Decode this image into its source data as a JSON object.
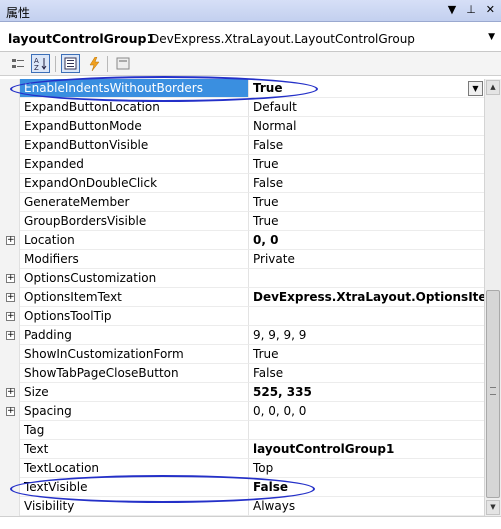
{
  "panel": {
    "title": "属性",
    "icons": [
      "dropdown-arrow-icon",
      "pin-icon",
      "close-icon"
    ]
  },
  "object_selector": {
    "name": "layoutControlGroup1",
    "type": "DevExpress.XtraLayout.LayoutControlGroup"
  },
  "toolbar": {
    "buttons": [
      {
        "name": "categorized-icon",
        "active": false
      },
      {
        "name": "alphabetical-sort-icon",
        "active": true
      },
      {
        "name": "properties-icon",
        "active": true
      },
      {
        "name": "events-lightning-icon",
        "active": false
      },
      {
        "name": "property-pages-icon",
        "active": false
      }
    ]
  },
  "properties": [
    {
      "name": "EnableIndentsWithoutBorders",
      "value": "True",
      "bold": true,
      "expandable": false,
      "selected": true
    },
    {
      "name": "ExpandButtonLocation",
      "value": "Default",
      "bold": false,
      "expandable": false
    },
    {
      "name": "ExpandButtonMode",
      "value": "Normal",
      "bold": false,
      "expandable": false
    },
    {
      "name": "ExpandButtonVisible",
      "value": "False",
      "bold": false,
      "expandable": false
    },
    {
      "name": "Expanded",
      "value": "True",
      "bold": false,
      "expandable": false
    },
    {
      "name": "ExpandOnDoubleClick",
      "value": "False",
      "bold": false,
      "expandable": false
    },
    {
      "name": "GenerateMember",
      "value": "True",
      "bold": false,
      "expandable": false
    },
    {
      "name": "GroupBordersVisible",
      "value": "True",
      "bold": false,
      "expandable": false
    },
    {
      "name": "Location",
      "value": "0, 0",
      "bold": true,
      "expandable": true
    },
    {
      "name": "Modifiers",
      "value": "Private",
      "bold": false,
      "expandable": false
    },
    {
      "name": "OptionsCustomization",
      "value": "",
      "bold": false,
      "expandable": true
    },
    {
      "name": "OptionsItemText",
      "value": "DevExpress.XtraLayout.OptionsItemTe",
      "bold": true,
      "expandable": true
    },
    {
      "name": "OptionsToolTip",
      "value": "",
      "bold": false,
      "expandable": true
    },
    {
      "name": "Padding",
      "value": "9, 9, 9, 9",
      "bold": false,
      "expandable": true
    },
    {
      "name": "ShowInCustomizationForm",
      "value": "True",
      "bold": false,
      "expandable": false
    },
    {
      "name": "ShowTabPageCloseButton",
      "value": "False",
      "bold": false,
      "expandable": false
    },
    {
      "name": "Size",
      "value": "525, 335",
      "bold": true,
      "expandable": true
    },
    {
      "name": "Spacing",
      "value": "0, 0, 0, 0",
      "bold": false,
      "expandable": true
    },
    {
      "name": "Tag",
      "value": "",
      "bold": false,
      "expandable": false
    },
    {
      "name": "Text",
      "value": "layoutControlGroup1",
      "bold": true,
      "expandable": false
    },
    {
      "name": "TextLocation",
      "value": "Top",
      "bold": false,
      "expandable": false
    },
    {
      "name": "TextVisible",
      "value": "False",
      "bold": true,
      "expandable": false
    },
    {
      "name": "Visibility",
      "value": "Always",
      "bold": false,
      "expandable": false
    }
  ],
  "colors": {
    "selection": "#3a8fe0",
    "highlight_oval": "#2430c8"
  }
}
